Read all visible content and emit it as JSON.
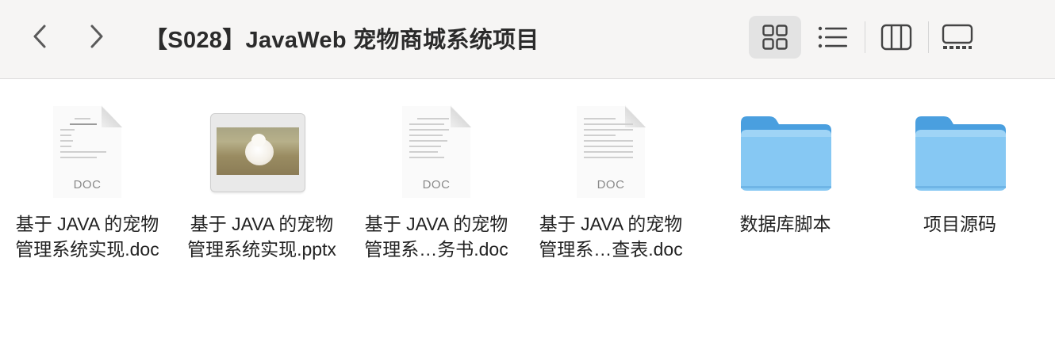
{
  "window": {
    "title": "【S028】JavaWeb 宠物商城系统项目"
  },
  "toolbar": {
    "back_icon": "chevron-left-icon",
    "forward_icon": "chevron-right-icon",
    "views": [
      {
        "name": "icon-view",
        "icon": "grid-icon",
        "active": true
      },
      {
        "name": "list-view",
        "icon": "list-icon",
        "active": false
      },
      {
        "name": "column-view",
        "icon": "columns-icon",
        "active": false
      },
      {
        "name": "gallery-view",
        "icon": "gallery-icon",
        "active": false
      }
    ]
  },
  "files": [
    {
      "line1": "基于 JAVA 的宠物",
      "line2": "管理系统实现.doc",
      "kind": "doc",
      "badge": "DOC"
    },
    {
      "line1": "基于 JAVA 的宠物",
      "line2": "管理系统实现.pptx",
      "kind": "pptx"
    },
    {
      "line1": "基于 JAVA 的宠物",
      "line2": "管理系…务书.doc",
      "kind": "doc",
      "badge": "DOC"
    },
    {
      "line1": "基于 JAVA 的宠物",
      "line2": "管理系…查表.doc",
      "kind": "doc",
      "badge": "DOC"
    },
    {
      "line1": "数据库脚本",
      "line2": "",
      "kind": "folder"
    },
    {
      "line1": "项目源码",
      "line2": "",
      "kind": "folder"
    }
  ],
  "colors": {
    "toolbar_bg": "#f6f5f4",
    "folder_top": "#4a9fdf",
    "folder_front": "#86c8f3",
    "active_view_bg": "#e3e3e3"
  }
}
